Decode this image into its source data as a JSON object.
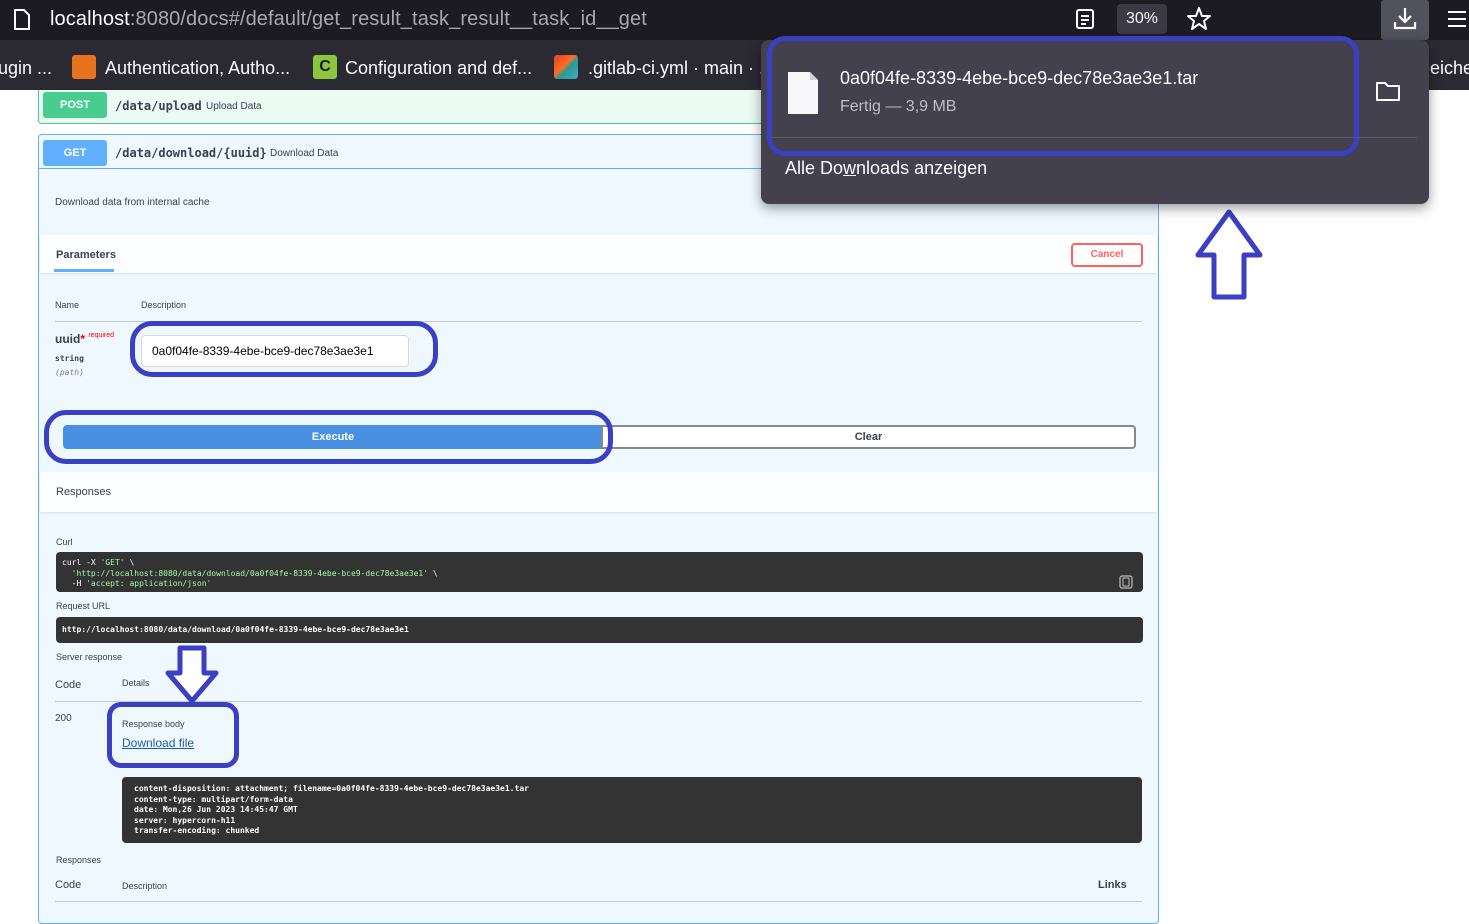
{
  "browser": {
    "url_host": "localhost",
    "url_rest": ":8080/docs#/default/get_result_task_result__task_id__get",
    "zoom": "30%"
  },
  "bookmarks": [
    {
      "label": "ugin ...",
      "icon": "none"
    },
    {
      "label": "Authentication, Autho...",
      "icon": "keycloak-icon"
    },
    {
      "label": "Configuration and def...",
      "icon": "c-icon"
    },
    {
      "label": ".gitlab-ci.yml · main · ...",
      "icon": "gitlab-icon"
    },
    {
      "label": "eicher",
      "icon": "none"
    }
  ],
  "post_op": {
    "method": "POST",
    "path": "/data/upload",
    "summary": "Upload Data"
  },
  "get_op": {
    "method": "GET",
    "path": "/data/download/{uuid}",
    "summary": "Download Data",
    "description": "Download data from internal cache",
    "parameters_tab": "Parameters",
    "cancel_label": "Cancel",
    "col_name": "Name",
    "col_description": "Description",
    "param": {
      "name": "uuid",
      "star": "*",
      "required": "required",
      "type": "string",
      "location": "(path)",
      "value": "0a0f04fe-8339-4ebe-bce9-dec78e3ae3e1"
    },
    "execute_label": "Execute",
    "clear_label": "Clear",
    "responses_header": "Responses",
    "curl_label": "Curl",
    "curl_line1": "curl -X ",
    "curl_line1_str": "'GET'",
    "curl_line1_end": " \\",
    "curl_line2": "  'http://localhost:8080/data/download/0a0f04fe-8339-4ebe-bce9-dec78e3ae3e1'",
    "curl_line2_end": " \\",
    "curl_line3": "  -H ",
    "curl_line3_str": "'accept: application/json'",
    "request_url_label": "Request URL",
    "request_url": "http://localhost:8080/data/download/0a0f04fe-8339-4ebe-bce9-dec78e3ae3e1",
    "server_response_label": "Server response",
    "code_label": "Code",
    "details_label": "Details",
    "status_code": "200",
    "response_body_label": "Response body",
    "download_link": "Download file",
    "headers": [
      "content-disposition: attachment; filename=0a0f04fe-8339-4ebe-bce9-dec78e3ae3e1.tar",
      "content-type: multipart/form-data",
      "date: Mon,26 Jun 2023 14:45:47 GMT",
      "server: hypercorn-h11",
      "transfer-encoding: chunked"
    ],
    "responses_label_2": "Responses",
    "code_label_2": "Code",
    "description_label_2": "Description",
    "links_label": "Links"
  },
  "download_panel": {
    "filename": "0a0f04fe-8339-4ebe-bce9-dec78e3ae3e1.tar",
    "status": "Fertig — 3,9 MB",
    "show_all_pre": "Alle Do",
    "show_all_u": "w",
    "show_all_post": "nloads anzeigen"
  },
  "colors": {
    "annotation": "#3b3fc3",
    "get": "#61affe",
    "post": "#49cc90",
    "execute": "#4990e2"
  }
}
